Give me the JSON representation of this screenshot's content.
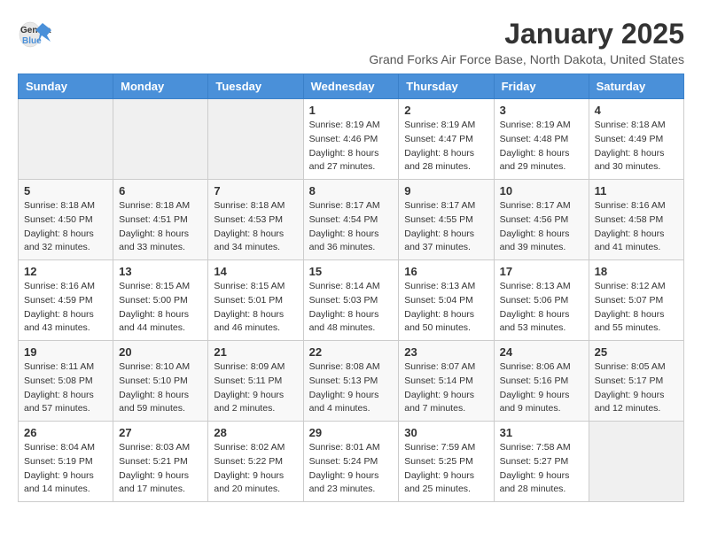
{
  "logo": {
    "text_general": "General",
    "text_blue": "Blue"
  },
  "title": "January 2025",
  "subtitle": "Grand Forks Air Force Base, North Dakota, United States",
  "days_of_week": [
    "Sunday",
    "Monday",
    "Tuesday",
    "Wednesday",
    "Thursday",
    "Friday",
    "Saturday"
  ],
  "weeks": [
    [
      {
        "day": "",
        "sunrise": "",
        "sunset": "",
        "daylight": ""
      },
      {
        "day": "",
        "sunrise": "",
        "sunset": "",
        "daylight": ""
      },
      {
        "day": "",
        "sunrise": "",
        "sunset": "",
        "daylight": ""
      },
      {
        "day": "1",
        "sunrise": "Sunrise: 8:19 AM",
        "sunset": "Sunset: 4:46 PM",
        "daylight": "Daylight: 8 hours and 27 minutes."
      },
      {
        "day": "2",
        "sunrise": "Sunrise: 8:19 AM",
        "sunset": "Sunset: 4:47 PM",
        "daylight": "Daylight: 8 hours and 28 minutes."
      },
      {
        "day": "3",
        "sunrise": "Sunrise: 8:19 AM",
        "sunset": "Sunset: 4:48 PM",
        "daylight": "Daylight: 8 hours and 29 minutes."
      },
      {
        "day": "4",
        "sunrise": "Sunrise: 8:18 AM",
        "sunset": "Sunset: 4:49 PM",
        "daylight": "Daylight: 8 hours and 30 minutes."
      }
    ],
    [
      {
        "day": "5",
        "sunrise": "Sunrise: 8:18 AM",
        "sunset": "Sunset: 4:50 PM",
        "daylight": "Daylight: 8 hours and 32 minutes."
      },
      {
        "day": "6",
        "sunrise": "Sunrise: 8:18 AM",
        "sunset": "Sunset: 4:51 PM",
        "daylight": "Daylight: 8 hours and 33 minutes."
      },
      {
        "day": "7",
        "sunrise": "Sunrise: 8:18 AM",
        "sunset": "Sunset: 4:53 PM",
        "daylight": "Daylight: 8 hours and 34 minutes."
      },
      {
        "day": "8",
        "sunrise": "Sunrise: 8:17 AM",
        "sunset": "Sunset: 4:54 PM",
        "daylight": "Daylight: 8 hours and 36 minutes."
      },
      {
        "day": "9",
        "sunrise": "Sunrise: 8:17 AM",
        "sunset": "Sunset: 4:55 PM",
        "daylight": "Daylight: 8 hours and 37 minutes."
      },
      {
        "day": "10",
        "sunrise": "Sunrise: 8:17 AM",
        "sunset": "Sunset: 4:56 PM",
        "daylight": "Daylight: 8 hours and 39 minutes."
      },
      {
        "day": "11",
        "sunrise": "Sunrise: 8:16 AM",
        "sunset": "Sunset: 4:58 PM",
        "daylight": "Daylight: 8 hours and 41 minutes."
      }
    ],
    [
      {
        "day": "12",
        "sunrise": "Sunrise: 8:16 AM",
        "sunset": "Sunset: 4:59 PM",
        "daylight": "Daylight: 8 hours and 43 minutes."
      },
      {
        "day": "13",
        "sunrise": "Sunrise: 8:15 AM",
        "sunset": "Sunset: 5:00 PM",
        "daylight": "Daylight: 8 hours and 44 minutes."
      },
      {
        "day": "14",
        "sunrise": "Sunrise: 8:15 AM",
        "sunset": "Sunset: 5:01 PM",
        "daylight": "Daylight: 8 hours and 46 minutes."
      },
      {
        "day": "15",
        "sunrise": "Sunrise: 8:14 AM",
        "sunset": "Sunset: 5:03 PM",
        "daylight": "Daylight: 8 hours and 48 minutes."
      },
      {
        "day": "16",
        "sunrise": "Sunrise: 8:13 AM",
        "sunset": "Sunset: 5:04 PM",
        "daylight": "Daylight: 8 hours and 50 minutes."
      },
      {
        "day": "17",
        "sunrise": "Sunrise: 8:13 AM",
        "sunset": "Sunset: 5:06 PM",
        "daylight": "Daylight: 8 hours and 53 minutes."
      },
      {
        "day": "18",
        "sunrise": "Sunrise: 8:12 AM",
        "sunset": "Sunset: 5:07 PM",
        "daylight": "Daylight: 8 hours and 55 minutes."
      }
    ],
    [
      {
        "day": "19",
        "sunrise": "Sunrise: 8:11 AM",
        "sunset": "Sunset: 5:08 PM",
        "daylight": "Daylight: 8 hours and 57 minutes."
      },
      {
        "day": "20",
        "sunrise": "Sunrise: 8:10 AM",
        "sunset": "Sunset: 5:10 PM",
        "daylight": "Daylight: 8 hours and 59 minutes."
      },
      {
        "day": "21",
        "sunrise": "Sunrise: 8:09 AM",
        "sunset": "Sunset: 5:11 PM",
        "daylight": "Daylight: 9 hours and 2 minutes."
      },
      {
        "day": "22",
        "sunrise": "Sunrise: 8:08 AM",
        "sunset": "Sunset: 5:13 PM",
        "daylight": "Daylight: 9 hours and 4 minutes."
      },
      {
        "day": "23",
        "sunrise": "Sunrise: 8:07 AM",
        "sunset": "Sunset: 5:14 PM",
        "daylight": "Daylight: 9 hours and 7 minutes."
      },
      {
        "day": "24",
        "sunrise": "Sunrise: 8:06 AM",
        "sunset": "Sunset: 5:16 PM",
        "daylight": "Daylight: 9 hours and 9 minutes."
      },
      {
        "day": "25",
        "sunrise": "Sunrise: 8:05 AM",
        "sunset": "Sunset: 5:17 PM",
        "daylight": "Daylight: 9 hours and 12 minutes."
      }
    ],
    [
      {
        "day": "26",
        "sunrise": "Sunrise: 8:04 AM",
        "sunset": "Sunset: 5:19 PM",
        "daylight": "Daylight: 9 hours and 14 minutes."
      },
      {
        "day": "27",
        "sunrise": "Sunrise: 8:03 AM",
        "sunset": "Sunset: 5:21 PM",
        "daylight": "Daylight: 9 hours and 17 minutes."
      },
      {
        "day": "28",
        "sunrise": "Sunrise: 8:02 AM",
        "sunset": "Sunset: 5:22 PM",
        "daylight": "Daylight: 9 hours and 20 minutes."
      },
      {
        "day": "29",
        "sunrise": "Sunrise: 8:01 AM",
        "sunset": "Sunset: 5:24 PM",
        "daylight": "Daylight: 9 hours and 23 minutes."
      },
      {
        "day": "30",
        "sunrise": "Sunrise: 7:59 AM",
        "sunset": "Sunset: 5:25 PM",
        "daylight": "Daylight: 9 hours and 25 minutes."
      },
      {
        "day": "31",
        "sunrise": "Sunrise: 7:58 AM",
        "sunset": "Sunset: 5:27 PM",
        "daylight": "Daylight: 9 hours and 28 minutes."
      },
      {
        "day": "",
        "sunrise": "",
        "sunset": "",
        "daylight": ""
      }
    ]
  ]
}
